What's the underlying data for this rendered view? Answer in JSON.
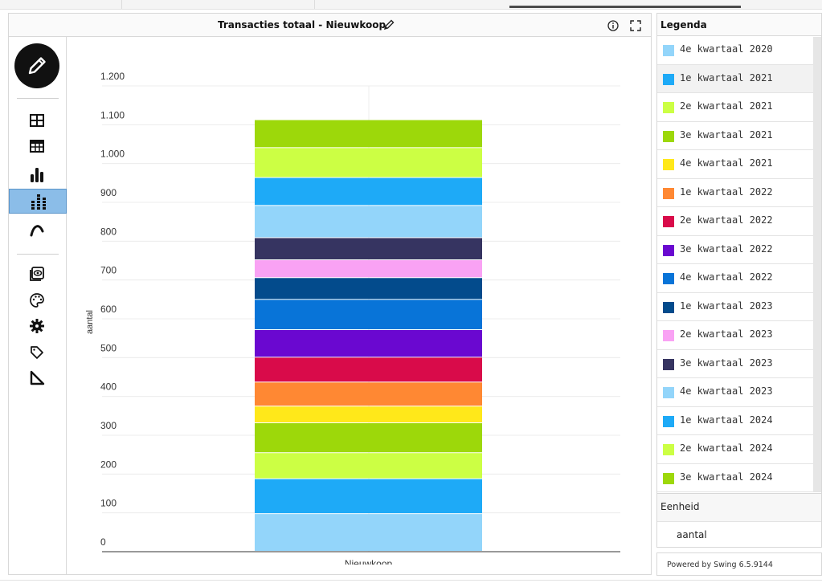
{
  "header": {
    "title": "Transacties totaal - Nieuwkoop"
  },
  "toolbar": {
    "tools": [
      {
        "icon": "table-icon"
      },
      {
        "icon": "pivot-table-icon"
      },
      {
        "icon": "bar-chart-icon"
      },
      {
        "icon": "stacked-bar-chart-icon",
        "active": true
      },
      {
        "icon": "line-chart-icon"
      },
      {
        "icon": "view-icon"
      },
      {
        "icon": "palette-icon"
      },
      {
        "icon": "settings-icon"
      },
      {
        "icon": "tag-icon"
      },
      {
        "icon": "axis-icon"
      }
    ]
  },
  "legend": {
    "heading": "Legenda",
    "unit_heading": "Eenheid",
    "unit_value": "aantal"
  },
  "footer": {
    "powered_by": "Powered by Swing 6.5.9144"
  },
  "chart_data": {
    "type": "bar",
    "stacked": true,
    "categories": [
      "Nieuwkoop"
    ],
    "ylabel": "aantal",
    "xlabel": "",
    "ylim": [
      0,
      1200
    ],
    "yticks": [
      "0",
      "100",
      "200",
      "300",
      "400",
      "500",
      "600",
      "700",
      "800",
      "900",
      "1.000",
      "1.100",
      "1.200"
    ],
    "grid": true,
    "legend_position": "right",
    "series": [
      {
        "name": "4e kwartaal 2020",
        "color": "#93d5fa",
        "values": [
          97
        ]
      },
      {
        "name": "1e kwartaal 2021",
        "color": "#1eaaf7",
        "values": [
          90
        ]
      },
      {
        "name": "2e kwartaal 2021",
        "color": "#ccff44",
        "values": [
          67
        ]
      },
      {
        "name": "3e kwartaal 2021",
        "color": "#9dd80a",
        "values": [
          77
        ]
      },
      {
        "name": "4e kwartaal 2021",
        "color": "#ffe81a",
        "values": [
          43
        ]
      },
      {
        "name": "1e kwartaal 2022",
        "color": "#ff8833",
        "values": [
          62
        ]
      },
      {
        "name": "2e kwartaal 2022",
        "color": "#d90b4a",
        "values": [
          64
        ]
      },
      {
        "name": "3e kwartaal 2022",
        "color": "#6a08d0",
        "values": [
          71
        ]
      },
      {
        "name": "4e kwartaal 2022",
        "color": "#0874d8",
        "values": [
          78
        ]
      },
      {
        "name": "1e kwartaal 2023",
        "color": "#034b8c",
        "values": [
          56
        ]
      },
      {
        "name": "2e kwartaal 2023",
        "color": "#f9a2f4",
        "values": [
          46
        ]
      },
      {
        "name": "3e kwartaal 2023",
        "color": "#363461",
        "values": [
          57
        ]
      },
      {
        "name": "4e kwartaal 2023",
        "color": "#93d5fa",
        "values": [
          83
        ]
      },
      {
        "name": "1e kwartaal 2024",
        "color": "#1eaaf7",
        "values": [
          72
        ]
      },
      {
        "name": "2e kwartaal 2024",
        "color": "#ccff44",
        "values": [
          77
        ]
      },
      {
        "name": "3e kwartaal 2024",
        "color": "#9dd80a",
        "values": [
          72
        ]
      }
    ]
  }
}
